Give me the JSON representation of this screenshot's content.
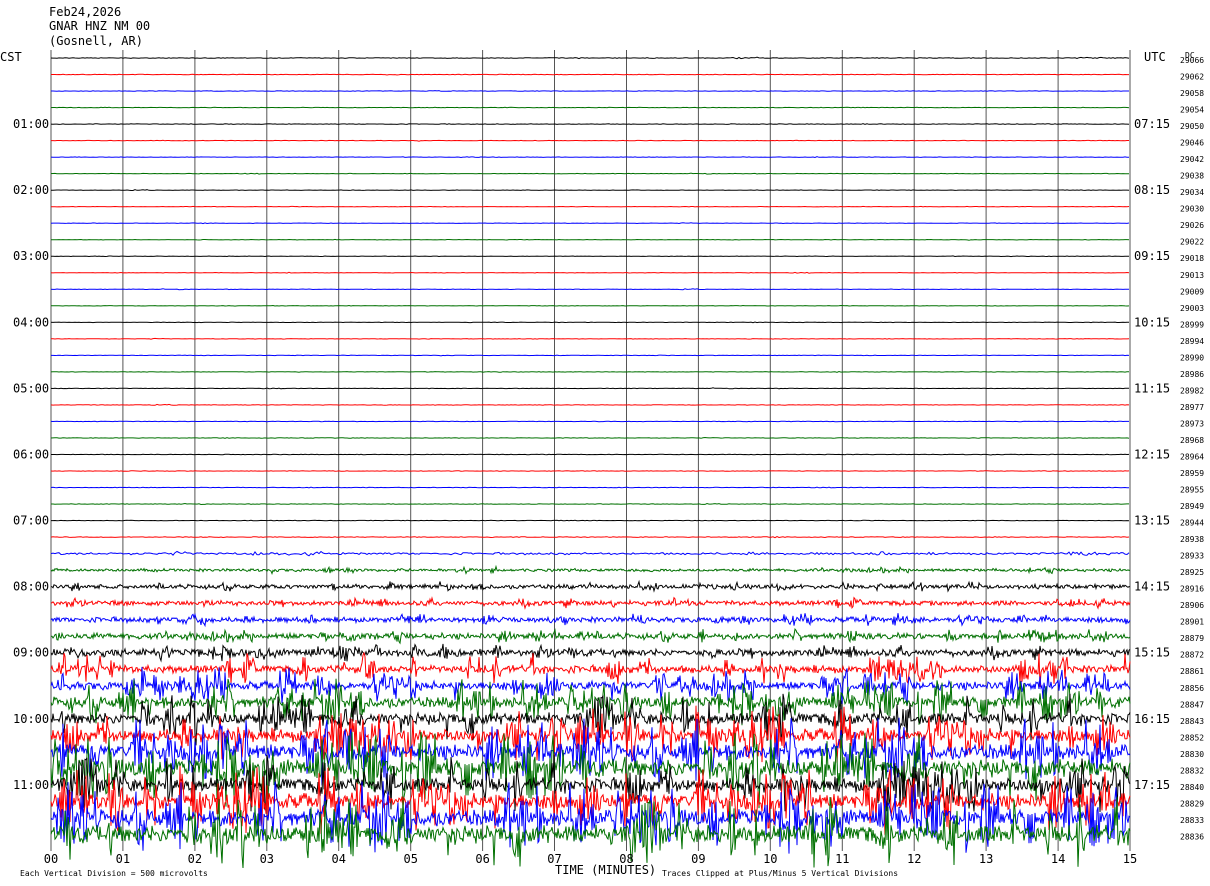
{
  "header": {
    "date": "Feb24,2026",
    "station": "GNAR HNZ NM 00",
    "location": "(Gosnell, AR)"
  },
  "chart_data": {
    "type": "line",
    "left_timezone": "CST",
    "right_timezone": "UTC",
    "dc_label": "DC",
    "xlabel": "TIME (MINUTES)",
    "x_ticks": [
      "00",
      "01",
      "02",
      "03",
      "04",
      "05",
      "06",
      "07",
      "08",
      "09",
      "10",
      "11",
      "12",
      "13",
      "14",
      "15"
    ],
    "xlim": [
      0,
      15
    ],
    "trace_count": 48,
    "trace_minutes": 15,
    "trace_colors": [
      "#000000",
      "#ff0000",
      "#0000ff",
      "#007000"
    ],
    "left_hour_labels": [
      "01:00",
      "02:00",
      "03:00",
      "04:00",
      "05:00",
      "06:00",
      "07:00",
      "08:00",
      "09:00",
      "10:00",
      "11:00"
    ],
    "right_hour_labels": [
      "07:15",
      "08:15",
      "09:15",
      "10:15",
      "11:15",
      "12:15",
      "13:15",
      "14:15",
      "15:15",
      "16:15",
      "17:15"
    ],
    "dc_offsets": [
      "29066",
      "29062",
      "29058",
      "29054",
      "29050",
      "29046",
      "29042",
      "29038",
      "29034",
      "29030",
      "29026",
      "29022",
      "29018",
      "29013",
      "29009",
      "29003",
      "28999",
      "28994",
      "28990",
      "28986",
      "28982",
      "28977",
      "28973",
      "28968",
      "28964",
      "28959",
      "28955",
      "28949",
      "28944",
      "28938",
      "28933",
      "28925",
      "28916",
      "28906",
      "28901",
      "28879",
      "28872",
      "28861",
      "28856",
      "28847",
      "28843",
      "28852",
      "28830",
      "28832",
      "28840",
      "28829",
      "28833",
      "28836"
    ],
    "activity_levels": [
      0.3,
      0.2,
      0.2,
      0.2,
      0.25,
      0.2,
      0.2,
      0.2,
      0.2,
      0.2,
      0.2,
      0.2,
      0.2,
      0.2,
      0.2,
      0.2,
      0.2,
      0.2,
      0.2,
      0.2,
      0.2,
      0.2,
      0.2,
      0.2,
      0.2,
      0.2,
      0.2,
      0.2,
      0.2,
      0.3,
      0.9,
      1.2,
      1.8,
      2.0,
      2.2,
      2.5,
      3.0,
      3.2,
      3.5,
      4.5,
      5.0,
      5.5,
      6.5,
      7.5,
      6.0,
      6.5,
      7.0,
      7.5
    ],
    "footer_left": "Each Vertical Division = 500 microvolts",
    "footer_right": "Traces Clipped at Plus/Minus 5 Vertical Divisions"
  }
}
